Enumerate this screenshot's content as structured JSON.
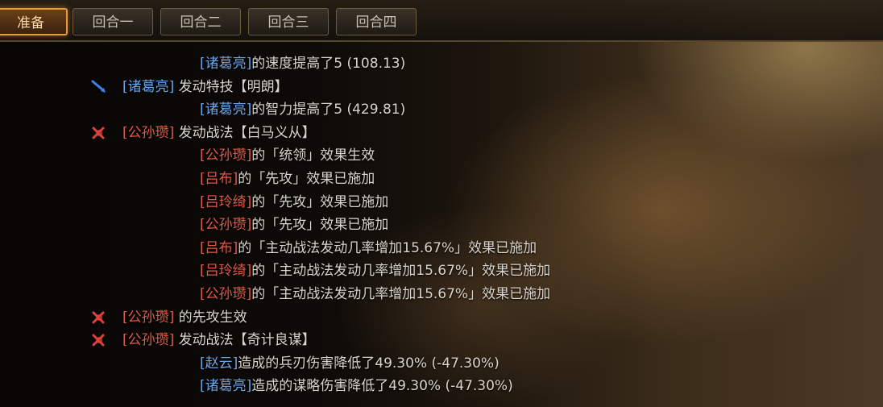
{
  "tabs": [
    "准备",
    "回合一",
    "回合二",
    "回合三",
    "回合四"
  ],
  "log": [
    {
      "kind": "indent",
      "name": "[诸葛亮]",
      "color": "blue",
      "text": "的速度提高了5 (108.13)"
    },
    {
      "kind": "head",
      "icon": "sword",
      "name": "[诸葛亮]",
      "color": "blue",
      "text": " 发动特技【明朗】"
    },
    {
      "kind": "indent",
      "name": "[诸葛亮]",
      "color": "blue",
      "text": "的智力提高了5 (429.81)"
    },
    {
      "kind": "head",
      "icon": "cross",
      "name": "[公孙瓒]",
      "color": "red",
      "text": " 发动战法【白马义从】"
    },
    {
      "kind": "indent",
      "name": "[公孙瓒]",
      "color": "red",
      "text": "的「统领」效果生效"
    },
    {
      "kind": "indent",
      "name": "[吕布]",
      "color": "red",
      "text": "的「先攻」效果已施加"
    },
    {
      "kind": "indent",
      "name": "[吕玲绮]",
      "color": "red",
      "text": "的「先攻」效果已施加"
    },
    {
      "kind": "indent",
      "name": "[公孙瓒]",
      "color": "red",
      "text": "的「先攻」效果已施加"
    },
    {
      "kind": "indent",
      "name": "[吕布]",
      "color": "red",
      "text": "的「主动战法发动几率增加15.67%」效果已施加"
    },
    {
      "kind": "indent",
      "name": "[吕玲绮]",
      "color": "red",
      "text": "的「主动战法发动几率增加15.67%」效果已施加"
    },
    {
      "kind": "indent",
      "name": "[公孙瓒]",
      "color": "red",
      "text": "的「主动战法发动几率增加15.67%」效果已施加"
    },
    {
      "kind": "head",
      "icon": "cross",
      "name": "[公孙瓒]",
      "color": "red",
      "text": " 的先攻生效"
    },
    {
      "kind": "head",
      "icon": "cross",
      "name": "[公孙瓒]",
      "color": "red",
      "text": " 发动战法【奇计良谋】"
    },
    {
      "kind": "indent",
      "name": "[赵云]",
      "color": "blue",
      "text": "造成的兵刃伤害降低了49.30% (-47.30%)"
    },
    {
      "kind": "indent",
      "name": "[诸葛亮]",
      "color": "blue",
      "text": "造成的谋略伤害降低了49.30% (-47.30%)"
    }
  ]
}
